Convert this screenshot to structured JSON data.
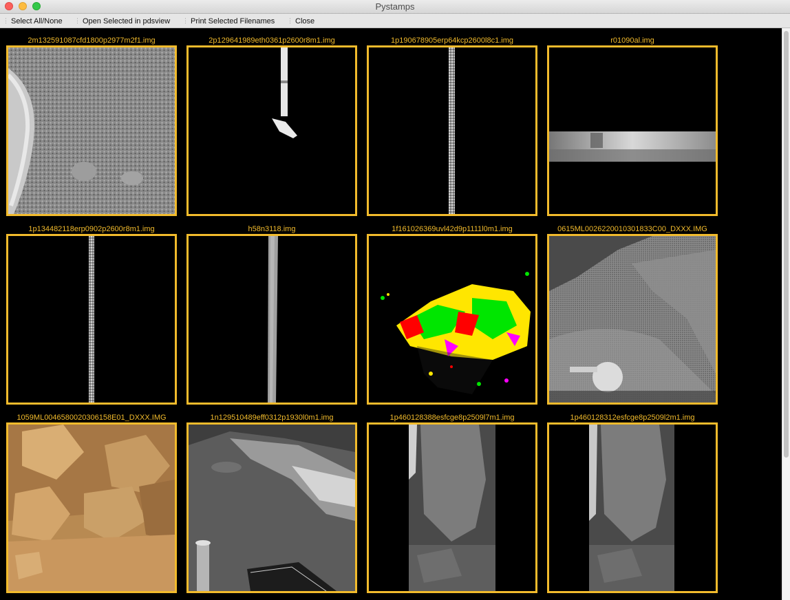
{
  "window": {
    "title": "Pystamps"
  },
  "toolbar": {
    "select_all": "Select All/None",
    "open_selected": "Open Selected in pdsview",
    "print_selected": "Print Selected Filenames",
    "close": "Close"
  },
  "stamps": [
    {
      "filename": "2m132591087cfd1800p2977m2f1.img"
    },
    {
      "filename": "2p129641989eth0361p2600r8m1.img"
    },
    {
      "filename": "1p190678905erp64kcp2600l8c1.img"
    },
    {
      "filename": "r01090al.img"
    },
    {
      "filename": "1p134482118erp0902p2600r8m1.img"
    },
    {
      "filename": "h58n3118.img"
    },
    {
      "filename": "1f161026369uvl42d9p1111l0m1.img"
    },
    {
      "filename": "0615ML0026220010301833C00_DXXX.IMG"
    },
    {
      "filename": "1059ML0046580020306158E01_DXXX.IMG"
    },
    {
      "filename": "1n129510489eff0312p1930l0m1.img"
    },
    {
      "filename": "1p460128388esfcge8p2509l7m1.img"
    },
    {
      "filename": "1p460128312esfcge8p2509l2m1.img"
    }
  ],
  "colors": {
    "selection_border": "#f2bb2c",
    "filename_text": "#f2bb2c",
    "background": "#000000"
  }
}
